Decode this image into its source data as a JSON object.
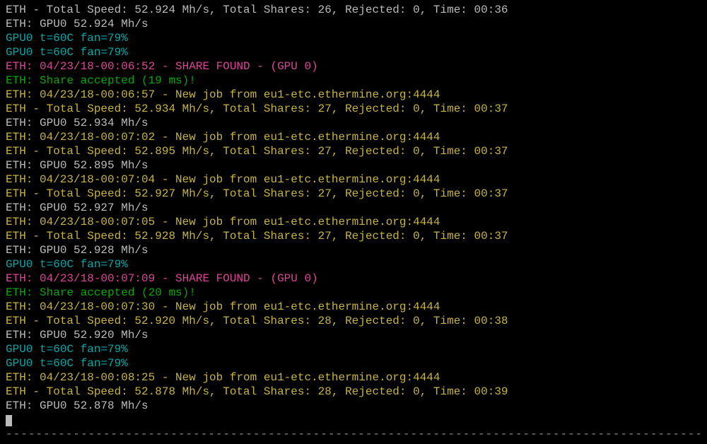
{
  "lines": [
    {
      "cls": "c-white",
      "text": "ETH - Total Speed: 52.924 Mh/s, Total Shares: 26, Rejected: 0, Time: 00:36"
    },
    {
      "cls": "c-white",
      "text": "ETH: GPU0 52.924 Mh/s"
    },
    {
      "cls": "c-teal",
      "text": "GPU0 t=60C fan=79%"
    },
    {
      "cls": "c-teal",
      "text": "GPU0 t=60C fan=79%"
    },
    {
      "cls": "c-magenta",
      "text": "ETH: 04/23/18-00:06:52 - SHARE FOUND - (GPU 0)"
    },
    {
      "cls": "c-green",
      "text": "ETH: Share accepted (19 ms)!"
    },
    {
      "cls": "c-yellow",
      "text": "ETH: 04/23/18-00:06:57 - New job from eu1-etc.ethermine.org:4444"
    },
    {
      "cls": "c-yellow",
      "text": "ETH - Total Speed: 52.934 Mh/s, Total Shares: 27, Rejected: 0, Time: 00:37"
    },
    {
      "cls": "c-white",
      "text": "ETH: GPU0 52.934 Mh/s"
    },
    {
      "cls": "c-yellow",
      "text": "ETH: 04/23/18-00:07:02 - New job from eu1-etc.ethermine.org:4444"
    },
    {
      "cls": "c-yellow",
      "text": "ETH - Total Speed: 52.895 Mh/s, Total Shares: 27, Rejected: 0, Time: 00:37"
    },
    {
      "cls": "c-white",
      "text": "ETH: GPU0 52.895 Mh/s"
    },
    {
      "cls": "c-yellow",
      "text": "ETH: 04/23/18-00:07:04 - New job from eu1-etc.ethermine.org:4444"
    },
    {
      "cls": "c-yellow",
      "text": "ETH - Total Speed: 52.927 Mh/s, Total Shares: 27, Rejected: 0, Time: 00:37"
    },
    {
      "cls": "c-white",
      "text": "ETH: GPU0 52.927 Mh/s"
    },
    {
      "cls": "c-yellow",
      "text": "ETH: 04/23/18-00:07:05 - New job from eu1-etc.ethermine.org:4444"
    },
    {
      "cls": "c-yellow",
      "text": "ETH - Total Speed: 52.928 Mh/s, Total Shares: 27, Rejected: 0, Time: 00:37"
    },
    {
      "cls": "c-white",
      "text": "ETH: GPU0 52.928 Mh/s"
    },
    {
      "cls": "c-teal",
      "text": "GPU0 t=60C fan=79%"
    },
    {
      "cls": "c-magenta",
      "text": "ETH: 04/23/18-00:07:09 - SHARE FOUND - (GPU 0)"
    },
    {
      "cls": "c-green",
      "text": "ETH: Share accepted (20 ms)!"
    },
    {
      "cls": "c-yellow",
      "text": "ETH: 04/23/18-00:07:30 - New job from eu1-etc.ethermine.org:4444"
    },
    {
      "cls": "c-yellow",
      "text": "ETH - Total Speed: 52.920 Mh/s, Total Shares: 28, Rejected: 0, Time: 00:38"
    },
    {
      "cls": "c-white",
      "text": "ETH: GPU0 52.920 Mh/s"
    },
    {
      "cls": "c-teal",
      "text": "GPU0 t=60C fan=79%"
    },
    {
      "cls": "c-teal",
      "text": "GPU0 t=60C fan=79%"
    },
    {
      "cls": "c-yellow",
      "text": "ETH: 04/23/18-00:08:25 - New job from eu1-etc.ethermine.org:4444"
    },
    {
      "cls": "c-yellow",
      "text": "ETH - Total Speed: 52.878 Mh/s, Total Shares: 28, Rejected: 0, Time: 00:39"
    },
    {
      "cls": "c-white",
      "text": "ETH: GPU0 52.878 Mh/s"
    }
  ],
  "separator": "------------------------------------------------------------------------------------------------------------"
}
